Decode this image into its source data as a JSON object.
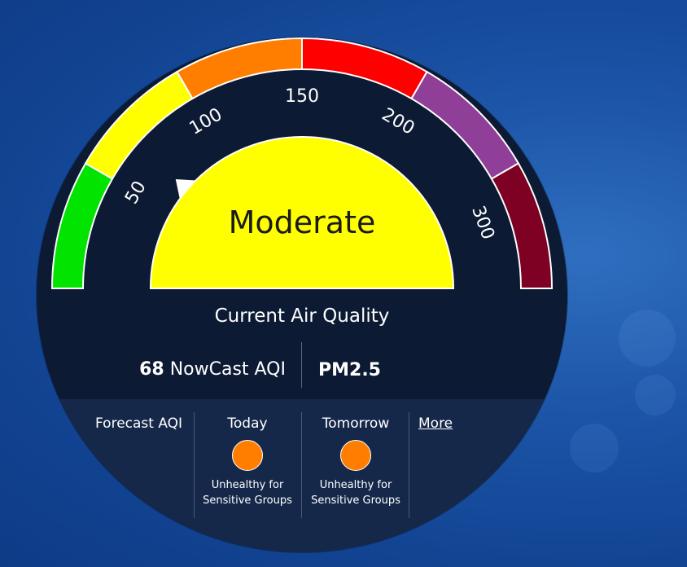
{
  "gauge": {
    "tick_labels": [
      "50",
      "100",
      "150",
      "200",
      "300"
    ],
    "segment_colors": [
      "#00e400",
      "#ffff00",
      "#ff7e00",
      "#ff0000",
      "#8f3f97",
      "#7e0023"
    ],
    "current_value": 68,
    "status": "Moderate",
    "status_color": "#ffff00"
  },
  "current": {
    "title": "Current Air Quality",
    "aqi_value": "68",
    "aqi_label": "NowCast AQI",
    "pollutant": "PM2.5"
  },
  "forecast": {
    "label": "Forecast AQI",
    "days": [
      {
        "name": "Today",
        "category_line1": "Unhealthy for",
        "category_line2": "Sensitive Groups",
        "color": "#ff7e00"
      },
      {
        "name": "Tomorrow",
        "category_line1": "Unhealthy for",
        "category_line2": "Sensitive Groups",
        "color": "#ff7e00"
      }
    ],
    "more_label": "More"
  }
}
